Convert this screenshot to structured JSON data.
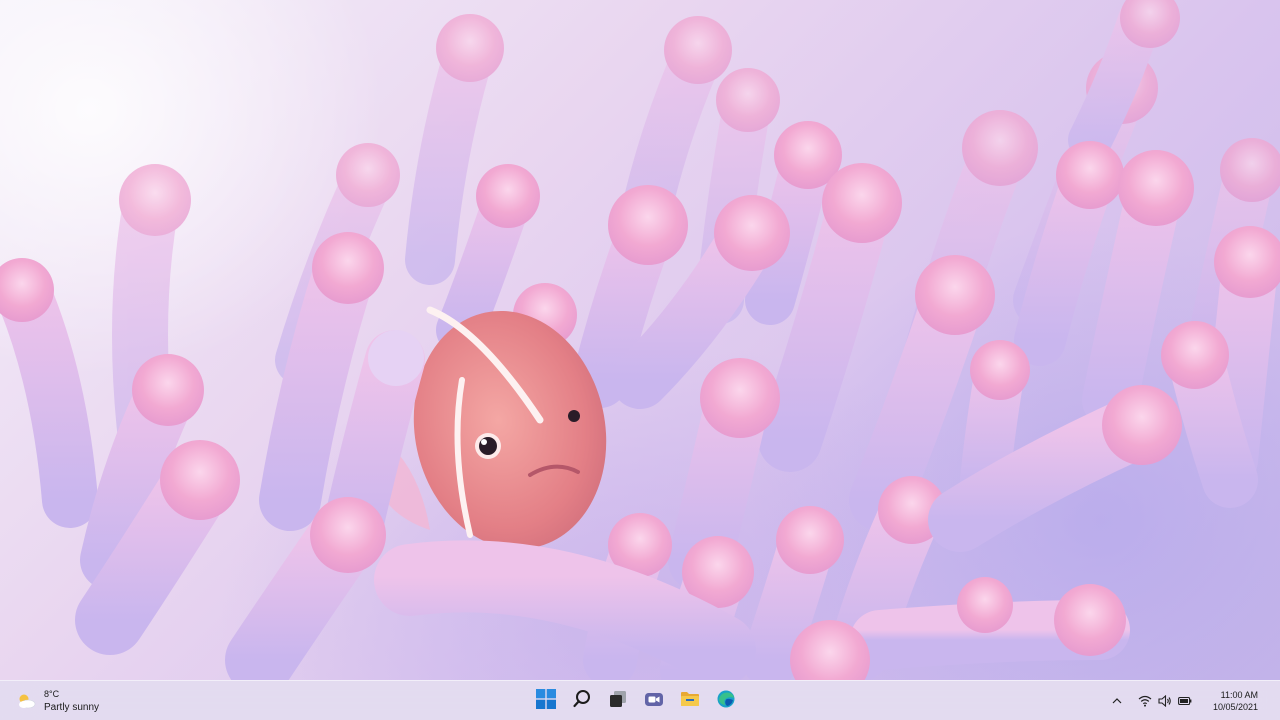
{
  "wallpaper": {
    "description_icon": "sea-anemone-clownfish-wallpaper",
    "colors": {
      "accent_pink": "#f3a6cf",
      "accent_lilac": "#c8b5ee",
      "fish": "#e98c8c"
    }
  },
  "taskbar": {
    "weather": {
      "icon": "partly-cloudy-icon",
      "temperature": "8°C",
      "condition": "Partly sunny"
    },
    "apps": [
      {
        "name": "start",
        "icon": "windows-logo-icon"
      },
      {
        "name": "search",
        "icon": "search-icon"
      },
      {
        "name": "task-view",
        "icon": "task-view-icon"
      },
      {
        "name": "chat",
        "icon": "teams-chat-icon"
      },
      {
        "name": "file-explorer",
        "icon": "folder-icon"
      },
      {
        "name": "edge",
        "icon": "edge-browser-icon"
      }
    ],
    "tray": {
      "chevron": "^",
      "icons": [
        "wifi-icon",
        "speaker-icon",
        "battery-icon"
      ]
    },
    "clock": {
      "time": "11:00 AM",
      "date": "10/05/2021"
    },
    "colors": {
      "start_blue": "#0f6cbd",
      "folder_yellow": "#f2c14e",
      "teams_purple": "#6264a7",
      "edge_teal": "#1aa2c8"
    }
  }
}
